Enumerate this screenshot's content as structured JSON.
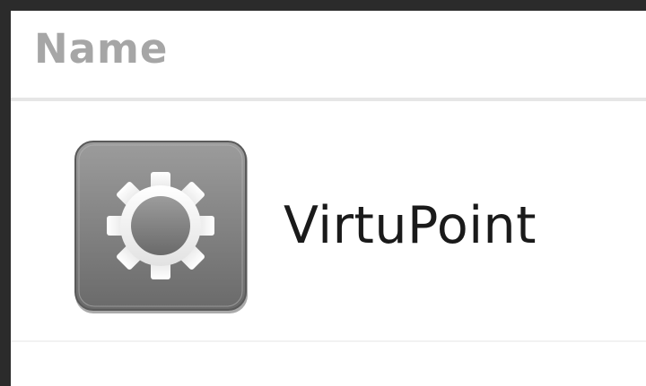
{
  "header": {
    "column_label": "Name"
  },
  "rows": [
    {
      "label": "VirtuPoint",
      "icon": "gear-icon"
    }
  ]
}
